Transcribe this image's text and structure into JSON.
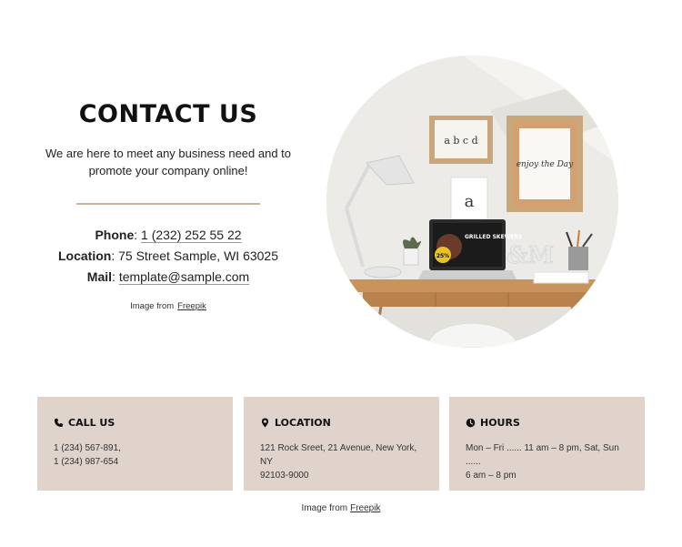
{
  "hero": {
    "title": "CONTACT US",
    "intro": "We are here to meet any business need and to promote your company online!",
    "phone_label": "Phone",
    "phone_value": "1 (232) 252 55 22",
    "location_label": "Location",
    "location_value": "75 Street Sample, WI 63025",
    "mail_label": "Mail",
    "mail_value": "template@sample.com",
    "credit_text": "Image from",
    "credit_link": "Freepik"
  },
  "photo": {
    "frame_letters": "a b c d",
    "frame_letter_a": "a",
    "frame_script": "enjoy the Day",
    "laptop_text": "GRILLED SKEWERS",
    "laptop_badge": "25%",
    "desk_letters": "&M"
  },
  "cards": [
    {
      "icon": "phone-icon",
      "title": "CALL US",
      "line1": "1 (234) 567-891,",
      "line2": "1 (234) 987-654"
    },
    {
      "icon": "location-pin-icon",
      "title": "LOCATION",
      "line1": "121 Rock Sreet, 21 Avenue, New York, NY",
      "line2": "92103-9000"
    },
    {
      "icon": "clock-icon",
      "title": "HOURS",
      "line1": "Mon – Fri ...... 11 am – 8 pm, Sat, Sun  ......",
      "line2": "6 am – 8 pm"
    }
  ],
  "footer": {
    "credit_text": "Image from",
    "credit_link": "Freepik"
  },
  "colors": {
    "card_bg": "#e0d3cb",
    "divider": "#c8b39e",
    "text": "#222222"
  }
}
